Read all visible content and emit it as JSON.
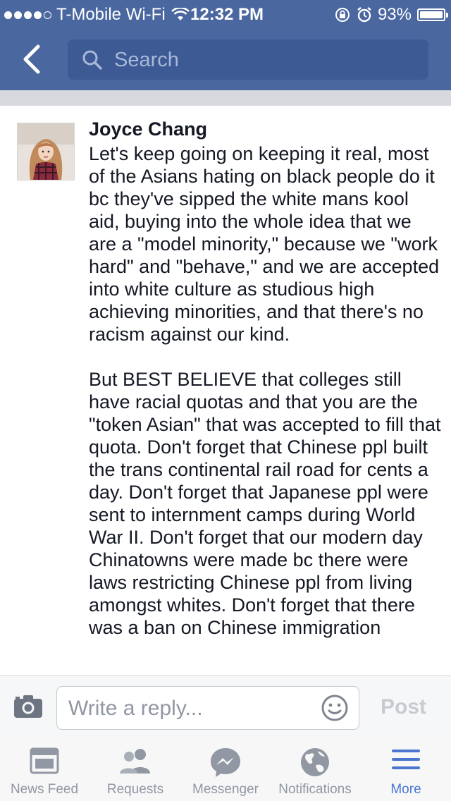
{
  "status_bar": {
    "carrier": "T-Mobile Wi-Fi",
    "time": "12:32 PM",
    "battery": "93%",
    "battery_level": 0.93
  },
  "nav": {
    "search_placeholder": "Search"
  },
  "comment": {
    "author": "Joyce Chang",
    "paragraph_1": "Let's keep going on keeping it real, most of the Asians hating on black people do it bc they've sipped the white mans kool aid, buying into the whole idea that we are a \"model minority,\" because we \"work hard\" and \"behave,\" and we are accepted into white culture as studious high achieving minorities, and that there's no racism against our kind.",
    "paragraph_2": "But BEST BELIEVE that colleges still have racial quotas and that you are the \"token Asian\" that was accepted to fill that quota. Don't forget that Chinese ppl built the trans continental rail road for cents a day. Don't forget that Japanese ppl were sent to internment camps during World War II. Don't forget that our modern day Chinatowns were made bc there were laws restricting Chinese ppl from living amongst whites. Don't forget that there was a ban on Chinese immigration"
  },
  "reply": {
    "placeholder": "Write a reply...",
    "post_label": "Post"
  },
  "tabs": [
    {
      "label": "News Feed",
      "icon": "news-feed-icon"
    },
    {
      "label": "Requests",
      "icon": "friend-requests-icon"
    },
    {
      "label": "Messenger",
      "icon": "messenger-icon"
    },
    {
      "label": "Notifications",
      "icon": "globe-icon"
    },
    {
      "label": "More",
      "icon": "menu-icon",
      "active": true
    }
  ],
  "colors": {
    "brand_blue": "#4b67a0",
    "search_bg": "#3d5a94",
    "active_tab": "#4a76d0",
    "inactive_tab": "#9197a3"
  }
}
